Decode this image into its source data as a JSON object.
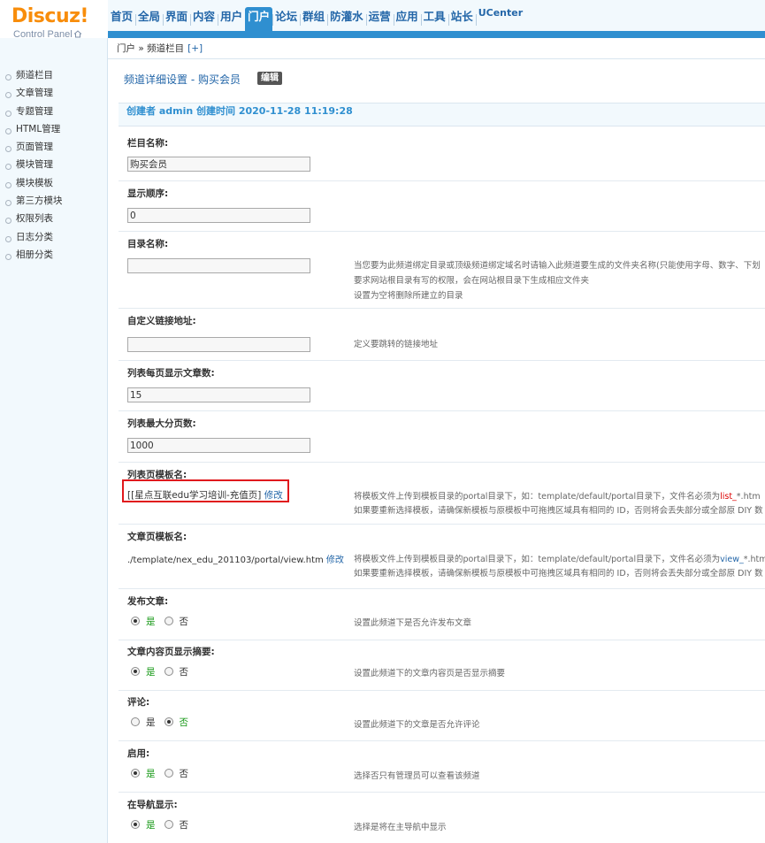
{
  "logo": {
    "brand": "Discuz!",
    "subtitle": "Control Panel"
  },
  "topnav": [
    "首页",
    "全局",
    "界面",
    "内容",
    "用户",
    "门户",
    "论坛",
    "群组",
    "防灌水",
    "运营",
    "应用",
    "工具",
    "站长",
    "UCenter"
  ],
  "topnav_active": "门户",
  "sidebar": [
    "频道栏目",
    "文章管理",
    "专题管理",
    "HTML管理",
    "页面管理",
    "模块管理",
    "模块模板",
    "第三方模块",
    "权限列表",
    "日志分类",
    "相册分类"
  ],
  "breadcrumb": {
    "text": "门户 » 频道栏目",
    "add": "[+]"
  },
  "page": {
    "title": "频道详细设置 - 购买会员",
    "edit_label": "编辑"
  },
  "info_bar": "创建者 admin 创建时间 2020-11-28 11:19:28",
  "fields": {
    "name": {
      "label": "栏目名称:",
      "value": "购买会员"
    },
    "order": {
      "label": "显示顺序:",
      "value": "0"
    },
    "dir": {
      "label": "目录名称:",
      "value": "",
      "hint1": "当您要为此频道绑定目录或顶级频道绑定域名时请输入此频道要生成的文件夹名称(只能使用字母、数字、下划",
      "hint2": "要求网站根目录有写的权限，会在网站根目录下生成相应文件夹",
      "hint3": "设置为空将删除所建立的目录"
    },
    "url": {
      "label": "自定义链接地址:",
      "value": "",
      "hint": "定义要跳转的链接地址"
    },
    "perpage": {
      "label": "列表每页显示文章数:",
      "value": "15"
    },
    "maxpage": {
      "label": "列表最大分页数:",
      "value": "1000"
    },
    "list_tpl": {
      "label": "列表页模板名:",
      "value": "[[星点互联edu学习培训-充值页]",
      "link": "修改",
      "hint1_a": "将模板文件上传到模板目录的portal目录下，如：template/default/portal目录下，文件名必须为",
      "hint1_b": "list_",
      "hint1_c": "*.htm",
      "hint2": "如果要重新选择模板，请确保新模板与原模板中可拖拽区域具有相同的 ID，否则将会丢失部分或全部原 DIY 数"
    },
    "view_tpl": {
      "label": "文章页模板名:",
      "value": "./template/nex_edu_201103/portal/view.htm",
      "link": "修改",
      "hint1_a": "将模板文件上传到模板目录的portal目录下，如：template/default/portal目录下，文件名必须为",
      "hint1_b": "view_",
      "hint1_c": "*.htm",
      "hint2": "如果要重新选择模板，请确保新模板与原模板中可拖拽区域具有相同的 ID，否则将会丢失部分或全部原 DIY 数"
    },
    "publish": {
      "label": "发布文章:",
      "yes": "是",
      "no": "否",
      "selected": "yes",
      "hint": "设置此频道下是否允许发布文章"
    },
    "summary": {
      "label": "文章内容页显示摘要:",
      "yes": "是",
      "no": "否",
      "selected": "yes",
      "hint": "设置此频道下的文章内容页是否显示摘要"
    },
    "comment": {
      "label": "评论:",
      "yes": "是",
      "no": "否",
      "selected": "no",
      "hint": "设置此频道下的文章是否允许评论"
    },
    "enable": {
      "label": "启用:",
      "yes": "是",
      "no": "否",
      "selected": "yes",
      "hint": "选择否只有管理员可以查看该频道"
    },
    "nav": {
      "label": "在导航显示:",
      "yes": "是",
      "no": "否",
      "selected": "yes",
      "hint": "选择是将在主导航中显示"
    }
  }
}
